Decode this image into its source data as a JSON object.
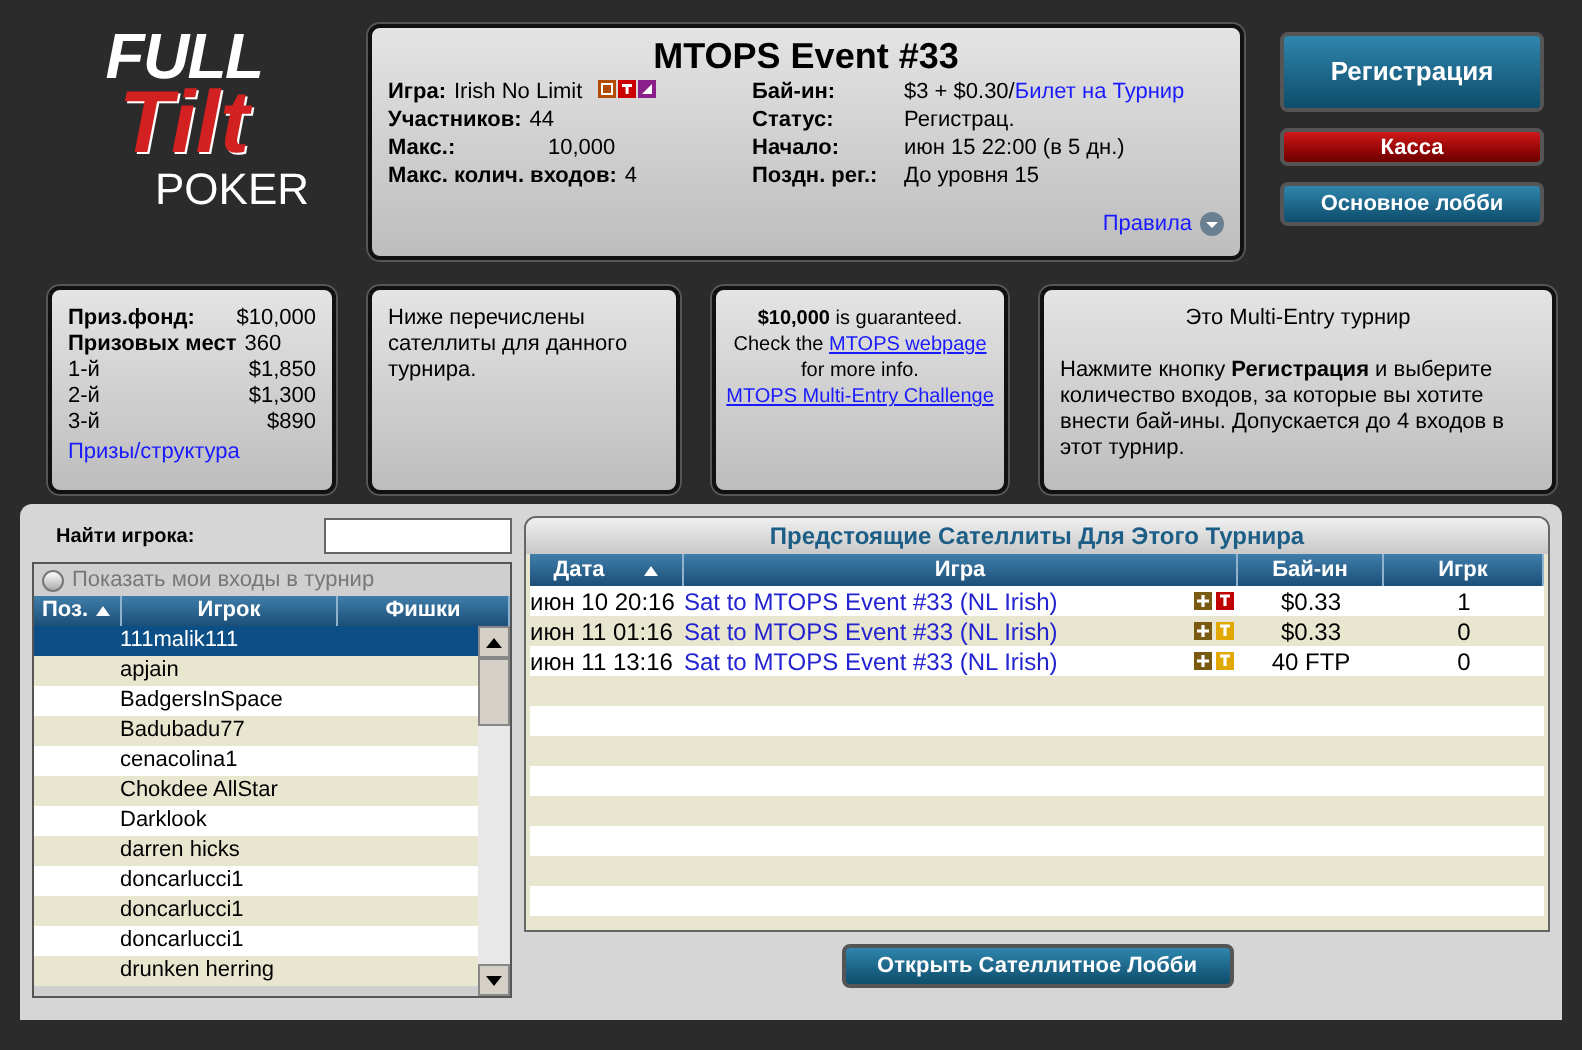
{
  "logo": {
    "line1": "FULL",
    "line2": "Tilt",
    "line3": "POKER"
  },
  "tournament": {
    "title": "MTOPS Event #33",
    "left": [
      {
        "label": "Игра:",
        "value": "Irish No Limit",
        "kind": "game"
      },
      {
        "label": "Участников:",
        "value": "44",
        "kind": "plain"
      },
      {
        "label": "Макс.:",
        "value": "10,000",
        "kind": "wide"
      },
      {
        "label": "Макс. колич. входов:",
        "value": "4",
        "kind": "plain"
      }
    ],
    "right": [
      {
        "label": "Бай-ин:",
        "value": "$3 + $0.30/",
        "link": "Билет на Турнир"
      },
      {
        "label": "Статус:",
        "value": "Регистрац."
      },
      {
        "label": "Начало:",
        "value": "июн 15 22:00 (в 5 дн.)"
      },
      {
        "label": "Поздн. рег.:",
        "value": "До уровня 15"
      }
    ],
    "rules_link": "Правила"
  },
  "buttons": [
    {
      "label": "Регистрация",
      "kind": "big"
    },
    {
      "label": "Касса",
      "kind": "red"
    },
    {
      "label": "Основное лобби",
      "kind": "blue"
    }
  ],
  "prizes": {
    "pool_label": "Приз.фонд:",
    "pool": "$10,000",
    "places_label": "Призовых мест",
    "places": "360",
    "rows": [
      {
        "place": "1-й",
        "amount": "$1,850"
      },
      {
        "place": "2-й",
        "amount": "$1,300"
      },
      {
        "place": "3-й",
        "amount": "$890"
      }
    ],
    "link": "Призы/структура"
  },
  "satellite_note": "Ниже перечислены сателлиты для данного турнира.",
  "guarantee": {
    "amount": "$10,000",
    "text1": "is guaranteed.",
    "text2": "Check the",
    "link1": "MTOPS webpage",
    "text3": "for more info.",
    "link2": "MTOPS Multi-Entry Challenge"
  },
  "multi_entry": {
    "title": "Это Multi-Entry турнир",
    "text": "Нажмите кнопку **Регистрация** и выберите количество входов, за которые вы хотите внести бай-ины. Допускается до 4 входов в этот турнир."
  },
  "find_player": {
    "label": "Найти игрока:"
  },
  "show_my_entries": {
    "label": "Показать мои входы в турнир",
    "checked": false
  },
  "players": {
    "columns": [
      "Поз.",
      "Игрок",
      "Фишки"
    ],
    "rows": [
      {
        "name": "111malik111",
        "selected": true
      },
      {
        "name": "apjain",
        "selected": false
      },
      {
        "name": "BadgersInSpace",
        "selected": false
      },
      {
        "name": "Badubadu77",
        "selected": false
      },
      {
        "name": "cenacolina1",
        "selected": false
      },
      {
        "name": "Chokdee AllStar",
        "selected": false
      },
      {
        "name": "Darklook",
        "selected": false
      },
      {
        "name": "darren hicks",
        "selected": false
      },
      {
        "name": "doncarlucci1",
        "selected": false
      },
      {
        "name": "doncarlucci1",
        "selected": false
      },
      {
        "name": "doncarlucci1",
        "selected": false
      },
      {
        "name": "drunken herring",
        "selected": false
      }
    ]
  },
  "satellites": {
    "title": "Предстоящие Сателлиты Для Этого Турнира",
    "columns": [
      "Дата",
      "Игра",
      "Бай-ин",
      "Игрк"
    ],
    "rows": [
      {
        "date": "июн 10 20:16",
        "game": "Sat to MTOPS Event #33 (NL Irish)",
        "color": "#c00000",
        "buyin": "$0.33",
        "players": "1"
      },
      {
        "date": "июн 11 01:16",
        "game": "Sat to MTOPS Event #33 (NL Irish)",
        "color": "#e0a800",
        "buyin": "$0.33",
        "players": "0"
      },
      {
        "date": "июн 11 13:16",
        "game": "Sat to MTOPS Event #33 (NL Irish)",
        "color": "#e0a800",
        "buyin": "40 FTP",
        "players": "0"
      }
    ],
    "open_button": "Открыть Сателлитное Лобби"
  }
}
